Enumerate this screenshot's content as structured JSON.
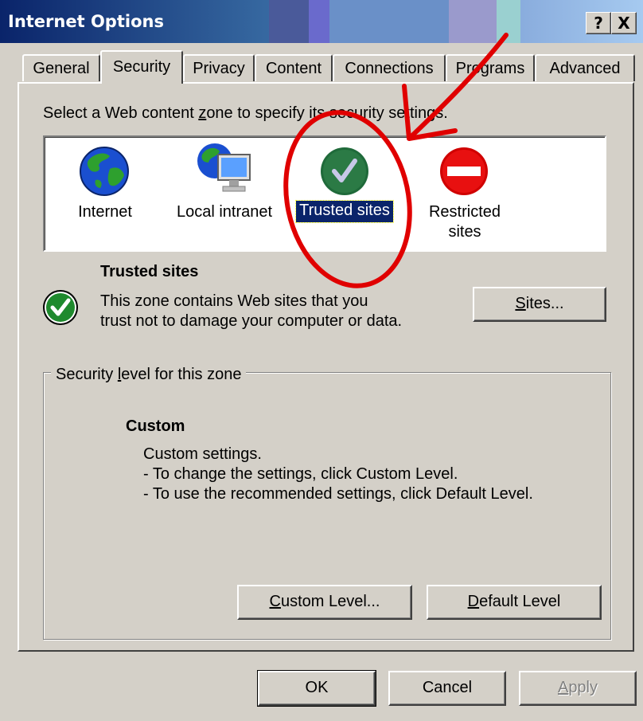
{
  "window": {
    "title": "Internet Options",
    "help_btn": "?",
    "close_btn": "X"
  },
  "tabs": [
    {
      "label": "General"
    },
    {
      "label": "Security"
    },
    {
      "label": "Privacy"
    },
    {
      "label": "Content"
    },
    {
      "label": "Connections"
    },
    {
      "label": "Programs"
    },
    {
      "label": "Advanced"
    }
  ],
  "security": {
    "instruction_pre": "Select a Web content ",
    "instruction_accel": "z",
    "instruction_post": "one to specify its security settings.",
    "zones": [
      {
        "label": "Internet",
        "icon": "globe-icon"
      },
      {
        "label": "Local intranet",
        "icon": "intranet-icon"
      },
      {
        "label": "Trusted sites",
        "icon": "check-icon",
        "selected": true
      },
      {
        "label": "Restricted sites",
        "icon": "no-entry-icon"
      }
    ],
    "selected_zone": {
      "title": "Trusted sites",
      "description": "This zone contains Web sites that you trust not to damage your computer or data."
    },
    "sites_button": {
      "accel": "S",
      "rest": "ites..."
    },
    "level_group": {
      "title_pre": "Security ",
      "title_accel": "l",
      "title_post": "evel for this zone"
    },
    "level": {
      "name": "Custom",
      "line1": "Custom settings.",
      "line2": "- To change the settings, click Custom Level.",
      "line3": "- To use the recommended settings, click Default Level."
    },
    "custom_level_button": {
      "accel": "C",
      "rest": "ustom Level..."
    },
    "default_level_button": {
      "accel": "D",
      "rest": "efault Level"
    }
  },
  "footer": {
    "ok": "OK",
    "cancel": "Cancel",
    "apply_accel": "A",
    "apply_rest": "pply"
  },
  "annotation": {
    "color": "#e00000"
  }
}
